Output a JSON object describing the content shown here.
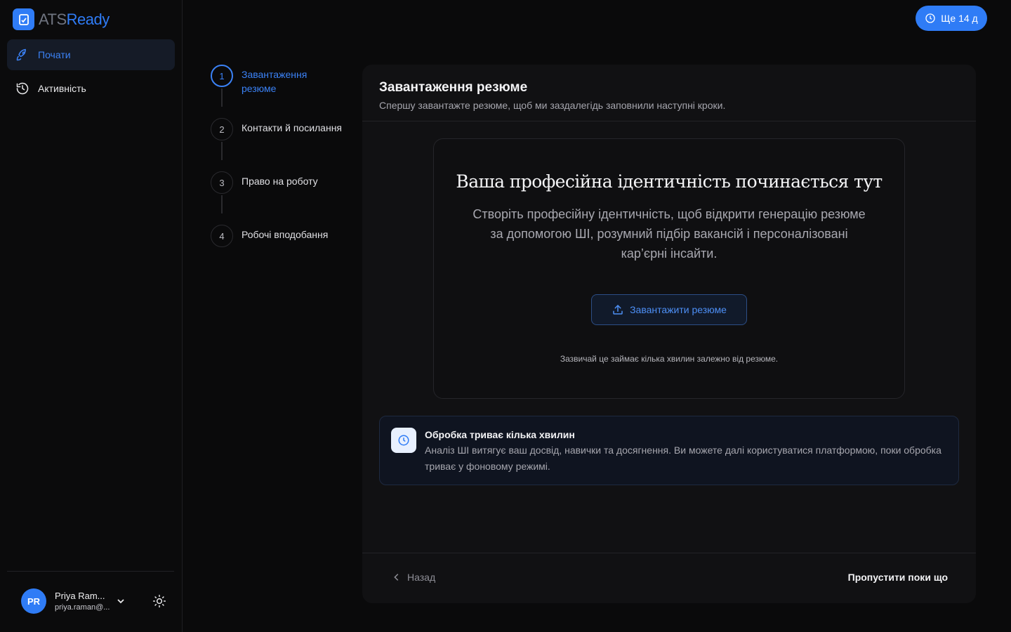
{
  "brand": {
    "name_part1": "ATS",
    "name_part2": "Ready"
  },
  "sidebar": {
    "items": [
      {
        "label": "Почати",
        "icon": "rocket-icon",
        "active": true
      },
      {
        "label": "Активність",
        "icon": "history-icon",
        "active": false
      }
    ]
  },
  "user": {
    "initials": "PR",
    "name": "Priya Ram...",
    "email": "priya.raman@..."
  },
  "header": {
    "trial_label": "Ще 14 д"
  },
  "steps": [
    {
      "number": "1",
      "label": "Завантаження резюме",
      "active": true
    },
    {
      "number": "2",
      "label": "Контакти й посилання",
      "active": false
    },
    {
      "number": "3",
      "label": "Право на роботу",
      "active": false
    },
    {
      "number": "4",
      "label": "Робочі вподобання",
      "active": false
    }
  ],
  "card": {
    "title": "Завантаження резюме",
    "subtitle": "Спершу завантажте резюме, щоб ми заздалегідь заповнили наступні кроки.",
    "upload": {
      "heading": "Ваша професійна ідентичність починається тут",
      "description": "Створіть професійну ідентичність, щоб відкрити генерацію резюме за допомогою ШІ, розумний підбір вакансій і персоналізовані кар’єрні інсайти.",
      "button_label": "Завантажити резюме",
      "note": "Зазвичай це займає кілька хвилин залежно від резюме."
    },
    "info": {
      "title": "Обробка триває кілька хвилин",
      "text": "Аналіз ШІ витягує ваш досвід, навички та досягнення. Ви можете далі користуватися платформою, поки обробка триває у фоновому режимі."
    },
    "footer": {
      "back_label": "Назад",
      "skip_label": "Пропустити поки що"
    }
  },
  "colors": {
    "accent": "#2f7cf6",
    "background": "#0a0a0b",
    "card": "#111113"
  }
}
